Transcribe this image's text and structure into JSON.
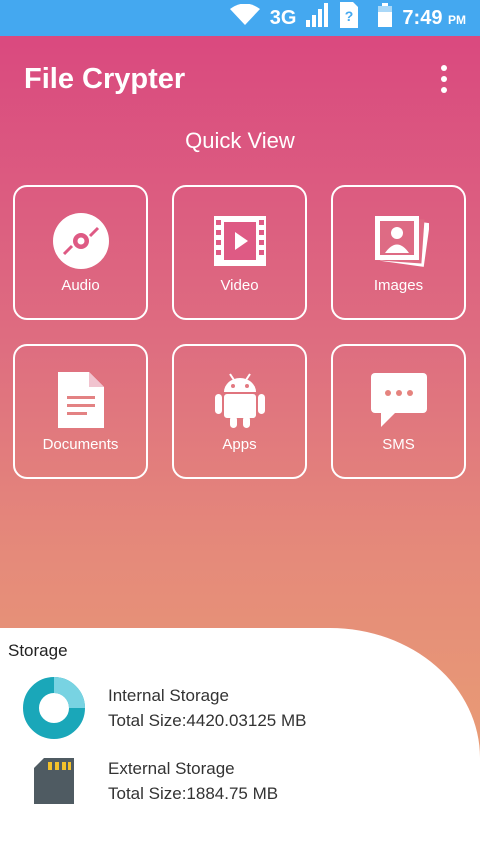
{
  "status_bar": {
    "network": "3G",
    "time": "7:49",
    "ampm": "PM"
  },
  "app_bar": {
    "title": "File Crypter"
  },
  "quick_view": {
    "title": "Quick View",
    "tiles": [
      {
        "label": "Audio",
        "icon": "audio-disc-icon"
      },
      {
        "label": "Video",
        "icon": "video-film-icon"
      },
      {
        "label": "Images",
        "icon": "images-icon"
      },
      {
        "label": "Documents",
        "icon": "document-icon"
      },
      {
        "label": "Apps",
        "icon": "android-icon"
      },
      {
        "label": "SMS",
        "icon": "sms-icon"
      }
    ]
  },
  "storage": {
    "title": "Storage",
    "internal": {
      "name": "Internal Storage",
      "size": "Total Size:4420.03125  MB"
    },
    "external": {
      "name": "External Storage",
      "size": "Total Size:1884.75  MB"
    }
  },
  "colors": {
    "status_bar": "#44a8f0",
    "gradient_top": "#d9457f",
    "gradient_bottom": "#eaa472",
    "storage_accent": "#1aa7b9",
    "sd_card": "#4f5b62"
  }
}
